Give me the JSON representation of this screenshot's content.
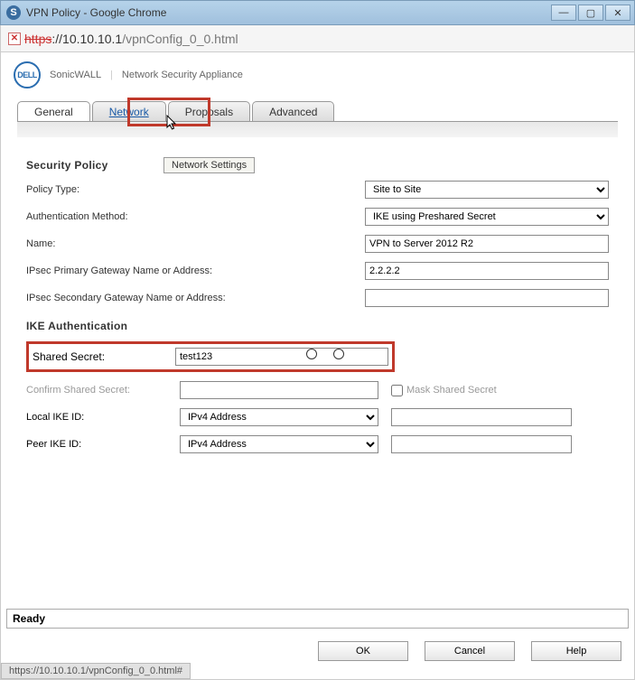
{
  "window": {
    "title": "VPN Policy - Google Chrome"
  },
  "address": {
    "scheme_struck": "https",
    "host": "://10.10.10.1",
    "path": "/vpnConfig_0_0.html"
  },
  "brand": {
    "logo_text": "DELL",
    "product": "SonicWALL",
    "subtitle": "Network Security Appliance"
  },
  "tabs": {
    "general": "General",
    "network": "Network",
    "proposals": "Proposals",
    "advanced": "Advanced"
  },
  "tooltip": "Network Settings",
  "section": {
    "security_policy": "Security Policy",
    "ike_auth": "IKE Authentication"
  },
  "fields": {
    "policy_type_label": "Policy Type:",
    "policy_type_value": "Site to Site",
    "auth_method_label": "Authentication Method:",
    "auth_method_value": "IKE using Preshared Secret",
    "name_label": "Name:",
    "name_value": "VPN to Server 2012 R2",
    "primary_gw_label": "IPsec Primary Gateway Name or Address:",
    "primary_gw_value": "2.2.2.2",
    "secondary_gw_label": "IPsec Secondary Gateway Name or Address:",
    "secondary_gw_value": ""
  },
  "ike": {
    "shared_secret_label": "Shared Secret:",
    "shared_secret_value": "test123",
    "confirm_label": "Confirm Shared Secret:",
    "confirm_value": "",
    "mask_label": "Mask Shared Secret",
    "local_id_label": "Local IKE ID:",
    "local_id_type": "IPv4 Address",
    "local_id_value": "",
    "peer_id_label": "Peer IKE ID:",
    "peer_id_type": "IPv4 Address",
    "peer_id_value": ""
  },
  "status": "Ready",
  "buttons": {
    "ok": "OK",
    "cancel": "Cancel",
    "help": "Help"
  },
  "footer_hint": "https://10.10.10.1/vpnConfig_0_0.html#"
}
